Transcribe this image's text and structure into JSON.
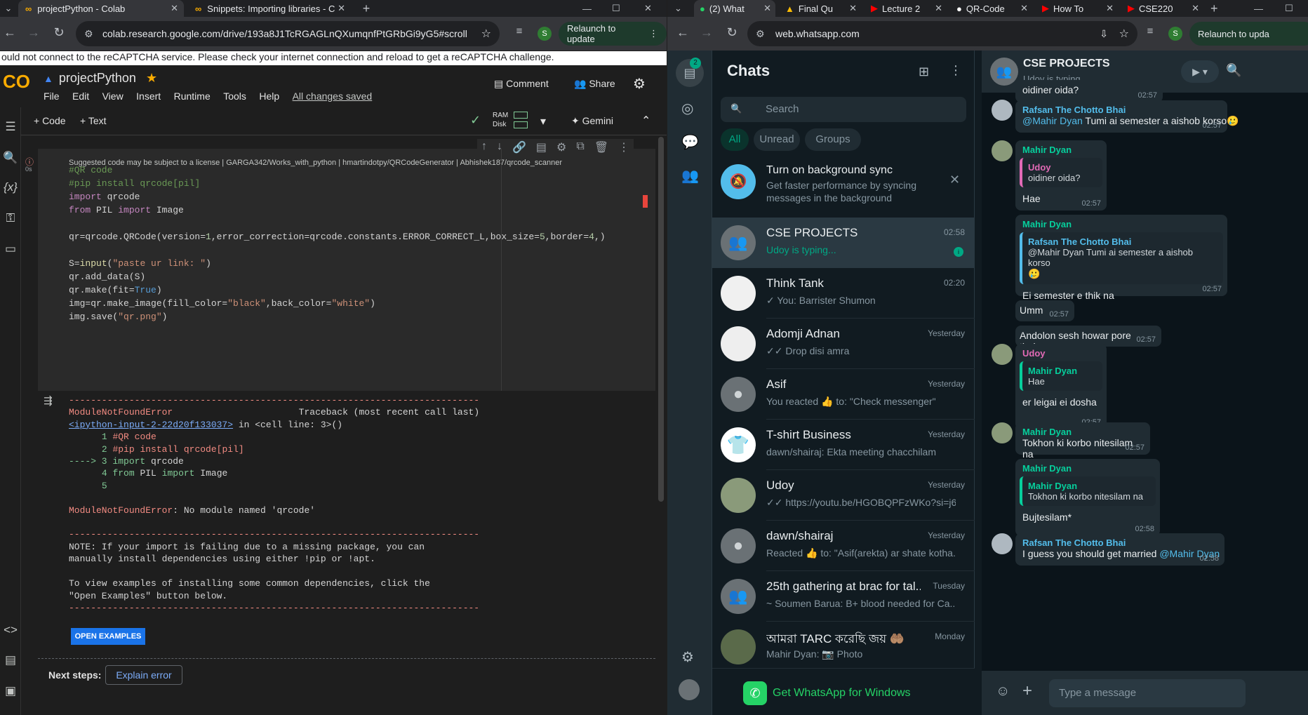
{
  "left_browser": {
    "tabs": [
      {
        "title": "projectPython - Colab"
      },
      {
        "title": "Snippets: Importing libraries - C"
      }
    ],
    "url": "colab.research.google.com/drive/193a8J1TcRGAGLnQXumqnfPtGRbGi9yG5#scrollT...",
    "relaunch": "Relaunch to update",
    "profile": "S"
  },
  "colab": {
    "recaptcha": "ould not connect to the reCAPTCHA service. Please check your internet connection and reload to get a reCAPTCHA challenge.",
    "notebook_name": "projectPython",
    "menu": [
      "File",
      "Edit",
      "View",
      "Insert",
      "Runtime",
      "Tools",
      "Help"
    ],
    "saved": "All changes saved",
    "comment": "Comment",
    "share": "Share",
    "add_code": "+ Code",
    "add_text": "+ Text",
    "ram": "RAM",
    "disk": "Disk",
    "gemini": "Gemini",
    "exec_time": "0s",
    "license": "Suggested code may be subject to a license | GARGA342/Works_with_python | hmartindotpy/QRCodeGenerator | Abhishek187/qrcode_scanner",
    "error_type": "ModuleNotFoundError",
    "traceback_label": "Traceback (most recent call last)",
    "traceback_link": "<ipython-input-2-22d20f133037>",
    "traceback_loc": " in <cell line: 3>()",
    "error_msg": ": No module named 'qrcode'",
    "note1": "NOTE: If your import is failing due to a missing package, you can",
    "note2": "manually install dependencies using either !pip or !apt.",
    "note3": "To view examples of installing some common dependencies, click the",
    "note4": "\"Open Examples\" button below.",
    "open_examples": "OPEN EXAMPLES",
    "next_steps": "Next steps:",
    "explain_error": "Explain error"
  },
  "right_browser": {
    "tabs": [
      "(2) What",
      "Final Qu",
      "Lecture 2",
      "QR-Code",
      "How To",
      "CSE220"
    ],
    "url": "web.whatsapp.com",
    "relaunch": "Relaunch to upda",
    "profile": "S"
  },
  "whatsapp": {
    "chats_title": "Chats",
    "badge": "2",
    "search_placeholder": "Search",
    "filters": [
      "All",
      "Unread",
      "Groups"
    ],
    "sync_title": "Turn on background sync",
    "sync_text1": "Get faster performance by syncing",
    "sync_text2": "messages in the background",
    "chats": [
      {
        "name": "CSE PROJECTS",
        "msg": "Udoy is typing...",
        "time": "02:58"
      },
      {
        "name": "Think Tank",
        "msg": "✓ You: Barrister Shumon",
        "time": "02:20"
      },
      {
        "name": "Adomji Adnan",
        "msg": "✓✓ Drop disi amra",
        "time": "Yesterday"
      },
      {
        "name": "Asif",
        "msg": "You reacted 👍 to: \"Check messenger\"",
        "time": "Yesterday"
      },
      {
        "name": "T-shirt Business",
        "msg": "dawn/shairaj: Ekta meeting chacchilam",
        "time": "Yesterday"
      },
      {
        "name": "Udoy",
        "msg": "✓✓ https://youtu.be/HGOBQPFzWKo?si=j6...",
        "time": "Yesterday"
      },
      {
        "name": "dawn/shairaj",
        "msg": "Reacted 👍 to: \"Asif(arekta) ar shate kotha...",
        "time": "Yesterday"
      },
      {
        "name": "25th gathering at brac for tal...",
        "msg": "~ Soumen Barua: B+ blood needed for Ca...",
        "time": "Tuesday"
      },
      {
        "name": "আমরা TARC করেছি জয় 🤲🏽",
        "msg": "Mahir Dyan: 📷 Photo",
        "time": "Monday"
      }
    ],
    "get_windows": "Get WhatsApp for Windows",
    "header_name": "CSE PROJECTS",
    "header_status": "Udoy is typing...",
    "input_placeholder": "Type a message",
    "messages": {
      "m0": {
        "text": "oidiner oida?",
        "time": "02:57"
      },
      "m1": {
        "sender": "Rafsan The Chotto Bhai",
        "mention": "@Mahir Dyan",
        "text": " Tumi ai semester a aishob korso🥲",
        "time": "02:57"
      },
      "m2": {
        "sender": "Mahir Dyan",
        "q_sender": "Udoy",
        "q_text": "oidiner oida?",
        "text": "Hae",
        "time": "02:57"
      },
      "m3": {
        "sender": "Mahir Dyan",
        "q_sender": "Rafsan The Chotto Bhai",
        "q_text": "@Mahir Dyan Tumi ai semester a aishob korso",
        "q_emoji": "🥲",
        "text": "Ei semester e thik na",
        "time": "02:57"
      },
      "m4": {
        "text": "Umm",
        "time": "02:57"
      },
      "m5": {
        "text": "Andolon sesh howar pore theke",
        "time": "02:57"
      },
      "m6": {
        "sender": "Udoy",
        "q_sender": "Mahir Dyan",
        "q_text": "Hae",
        "text": "er leigai ei dosha",
        "time": "02:57"
      },
      "m7": {
        "sender": "Mahir Dyan",
        "text": "Tokhon ki korbo nitesilam na",
        "time": "02:57"
      },
      "m8": {
        "sender": "Mahir Dyan",
        "q_sender": "Mahir Dyan",
        "q_text": "Tokhon ki korbo nitesilam na",
        "text": "Bujtesilam*",
        "time": "02:58"
      },
      "m9": {
        "sender": "Rafsan The Chotto Bhai",
        "text": "I guess you should get married ",
        "mention": "@Mahir Dyan",
        "time": "02:58"
      }
    }
  }
}
